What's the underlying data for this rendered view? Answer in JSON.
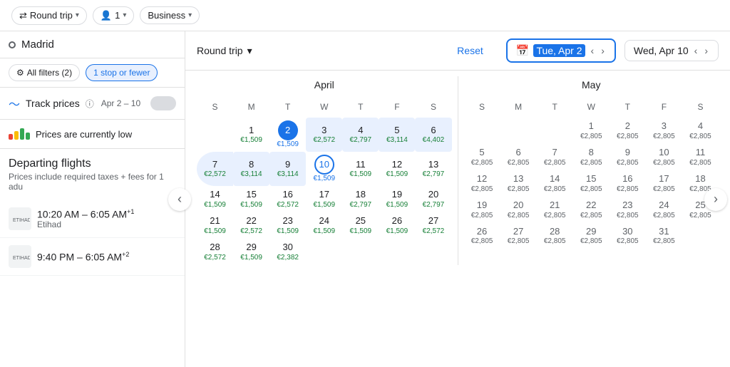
{
  "topbar": {
    "trip_type": "Round trip",
    "passengers": "1",
    "class": "Business"
  },
  "left_panel": {
    "search_location": "Madrid",
    "filter_label": "All filters (2)",
    "stop_filter": "1 stop or fewer",
    "track_prices_label": "Track prices",
    "track_info_icon": "ℹ",
    "track_date_range": "Apr 2 – 10",
    "prices_low_text": "Prices are currently low",
    "departing_title": "Departing flights",
    "departing_sub": "Prices include required taxes + fees for 1 adu",
    "flights": [
      {
        "time": "10:20 AM – 6:05 AM",
        "superscript": "+1",
        "airline": "Etihad"
      },
      {
        "time": "9:40 PM – 6:05 AM",
        "superscript": "+2",
        "airline": ""
      }
    ]
  },
  "calendar": {
    "trip_type": "Round trip",
    "reset_label": "Reset",
    "date_left": "Tue, Apr 2",
    "date_right": "Wed, Apr 10",
    "april": {
      "title": "April",
      "dow": [
        "S",
        "M",
        "T",
        "W",
        "T",
        "F",
        "S"
      ],
      "weeks": [
        [
          {
            "day": "",
            "price": ""
          },
          {
            "day": "1",
            "price": "€1,509"
          },
          {
            "day": "2",
            "price": "€1,509",
            "selected": true
          },
          {
            "day": "3",
            "price": "€2,572"
          },
          {
            "day": "4",
            "price": "€2,797"
          },
          {
            "day": "5",
            "price": "€3,114"
          },
          {
            "day": "6",
            "price": "€4,402"
          }
        ],
        [
          {
            "day": "7",
            "price": "€2,572",
            "inrange": true
          },
          {
            "day": "8",
            "price": "€3,114",
            "inrange": true
          },
          {
            "day": "9",
            "price": "€3,114",
            "inrange": true
          },
          {
            "day": "10",
            "price": "€1,509",
            "circle": true
          },
          {
            "day": "11",
            "price": "€1,509"
          },
          {
            "day": "12",
            "price": "€1,509"
          },
          {
            "day": "13",
            "price": "€2,797"
          }
        ],
        [
          {
            "day": "14",
            "price": "€1,509"
          },
          {
            "day": "15",
            "price": "€1,509"
          },
          {
            "day": "16",
            "price": "€2,572"
          },
          {
            "day": "17",
            "price": "€1,509"
          },
          {
            "day": "18",
            "price": "€2,797"
          },
          {
            "day": "19",
            "price": "€1,509"
          },
          {
            "day": "20",
            "price": "€2,797"
          }
        ],
        [
          {
            "day": "21",
            "price": "€1,509"
          },
          {
            "day": "22",
            "price": "€2,572"
          },
          {
            "day": "23",
            "price": "€1,509"
          },
          {
            "day": "24",
            "price": "€1,509"
          },
          {
            "day": "25",
            "price": "€1,509"
          },
          {
            "day": "26",
            "price": "€1,509"
          },
          {
            "day": "27",
            "price": "€2,572"
          }
        ],
        [
          {
            "day": "28",
            "price": "€2,572"
          },
          {
            "day": "29",
            "price": "€1,509"
          },
          {
            "day": "30",
            "price": "€2,382"
          },
          {
            "day": "",
            "price": ""
          },
          {
            "day": "",
            "price": ""
          },
          {
            "day": "",
            "price": ""
          },
          {
            "day": "",
            "price": ""
          }
        ]
      ]
    },
    "may": {
      "title": "May",
      "dow": [
        "S",
        "M",
        "T",
        "W",
        "T",
        "F",
        "S"
      ],
      "weeks": [
        [
          {
            "day": "",
            "price": ""
          },
          {
            "day": "",
            "price": ""
          },
          {
            "day": "",
            "price": ""
          },
          {
            "day": "1",
            "price": "€2,805"
          },
          {
            "day": "2",
            "price": "€2,805"
          },
          {
            "day": "3",
            "price": "€2,805"
          },
          {
            "day": "4",
            "price": "€2,805"
          }
        ],
        [
          {
            "day": "5",
            "price": "€2,805"
          },
          {
            "day": "6",
            "price": "€2,805"
          },
          {
            "day": "7",
            "price": "€2,805"
          },
          {
            "day": "8",
            "price": "€2,805"
          },
          {
            "day": "9",
            "price": "€2,805"
          },
          {
            "day": "10",
            "price": "€2,805"
          },
          {
            "day": "11",
            "price": "€2,805"
          }
        ],
        [
          {
            "day": "12",
            "price": "€2,805"
          },
          {
            "day": "13",
            "price": "€2,805"
          },
          {
            "day": "14",
            "price": "€2,805"
          },
          {
            "day": "15",
            "price": "€2,805"
          },
          {
            "day": "16",
            "price": "€2,805"
          },
          {
            "day": "17",
            "price": "€2,805"
          },
          {
            "day": "18",
            "price": "€2,805"
          }
        ],
        [
          {
            "day": "19",
            "price": "€2,805"
          },
          {
            "day": "20",
            "price": "€2,805"
          },
          {
            "day": "21",
            "price": "€2,805"
          },
          {
            "day": "22",
            "price": "€2,805"
          },
          {
            "day": "23",
            "price": "€2,805"
          },
          {
            "day": "24",
            "price": "€2,805"
          },
          {
            "day": "25",
            "price": "€2,805"
          }
        ],
        [
          {
            "day": "26",
            "price": "€2,805"
          },
          {
            "day": "27",
            "price": "€2,805"
          },
          {
            "day": "28",
            "price": "€2,805"
          },
          {
            "day": "29",
            "price": "€2,805"
          },
          {
            "day": "30",
            "price": "€2,805"
          },
          {
            "day": "31",
            "price": "€2,805"
          },
          {
            "day": "",
            "price": ""
          }
        ]
      ]
    }
  },
  "icons": {
    "chevron_down": "▾",
    "chevron_left": "‹",
    "chevron_right": "›",
    "round_trip": "⇄",
    "person": "👤",
    "filter": "⊞",
    "trending": "〜",
    "calendar": "📅",
    "info": "ⓘ"
  },
  "colors": {
    "blue": "#1a73e8",
    "green": "#188038",
    "light_blue": "#e8f0fe",
    "border": "#dadce0",
    "text_secondary": "#5f6368"
  }
}
